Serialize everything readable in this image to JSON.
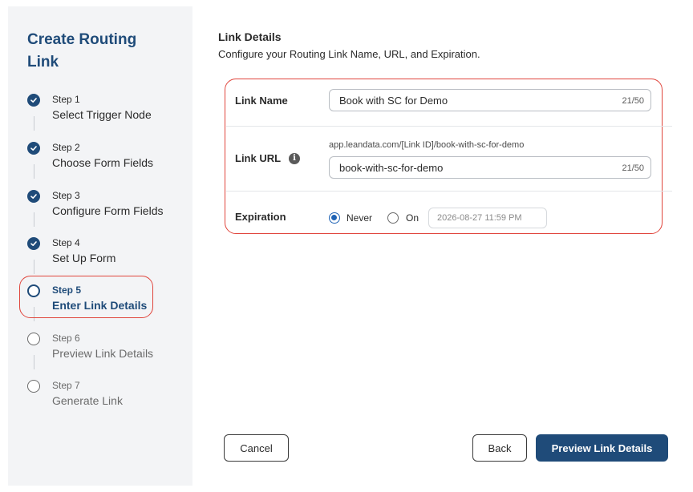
{
  "sidebar": {
    "title": "Create Routing Link",
    "steps": [
      {
        "num": "Step 1",
        "name": "Select Trigger Node",
        "state": "done"
      },
      {
        "num": "Step 2",
        "name": "Choose Form Fields",
        "state": "done"
      },
      {
        "num": "Step 3",
        "name": "Configure Form Fields",
        "state": "done"
      },
      {
        "num": "Step 4",
        "name": "Set Up Form",
        "state": "done"
      },
      {
        "num": "Step 5",
        "name": "Enter Link Details",
        "state": "current"
      },
      {
        "num": "Step 6",
        "name": "Preview Link Details",
        "state": "pending"
      },
      {
        "num": "Step 7",
        "name": "Generate Link",
        "state": "pending"
      }
    ]
  },
  "main": {
    "title": "Link Details",
    "subtitle": "Configure your Routing Link Name, URL, and Expiration."
  },
  "form": {
    "link_name": {
      "label": "Link Name",
      "value": "Book with SC for Demo",
      "count": "21/50"
    },
    "link_url": {
      "label": "Link URL",
      "preview": "app.leandata.com/[Link ID]/book-with-sc-for-demo",
      "value": "book-with-sc-for-demo",
      "count": "21/50"
    },
    "expiration": {
      "label": "Expiration",
      "options": [
        "Never",
        "On"
      ],
      "selected": "Never",
      "date_value": "2026-08-27 11:59 PM"
    }
  },
  "footer": {
    "cancel_label": "Cancel",
    "back_label": "Back",
    "next_label": "Preview Link Details"
  },
  "colors": {
    "brand": "#1f4b79",
    "highlight": "#e0453c",
    "sidebar_bg": "#f3f4f6"
  }
}
